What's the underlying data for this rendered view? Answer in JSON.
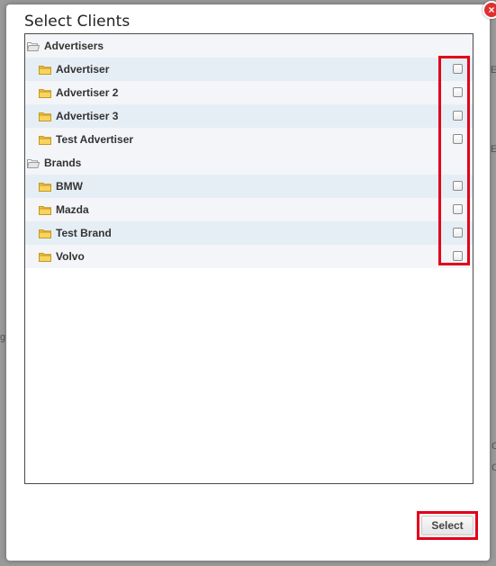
{
  "dialog": {
    "title": "Select Clients",
    "close_symbol": "×"
  },
  "tree": {
    "groups": [
      {
        "label": "Advertisers",
        "icon": "folder-open-icon",
        "items": [
          {
            "label": "Advertiser",
            "icon": "folder-icon",
            "checked": false
          },
          {
            "label": "Advertiser 2",
            "icon": "folder-icon",
            "checked": false
          },
          {
            "label": "Advertiser 3",
            "icon": "folder-icon",
            "checked": false
          },
          {
            "label": "Test Advertiser",
            "icon": "folder-icon",
            "checked": false
          }
        ]
      },
      {
        "label": "Brands",
        "icon": "folder-open-icon",
        "items": [
          {
            "label": "BMW",
            "icon": "folder-icon",
            "checked": false
          },
          {
            "label": "Mazda",
            "icon": "folder-icon",
            "checked": false
          },
          {
            "label": "Test Brand",
            "icon": "folder-icon",
            "checked": false
          },
          {
            "label": "Volvo",
            "icon": "folder-icon",
            "checked": false
          }
        ]
      }
    ]
  },
  "footer": {
    "select_label": "Select"
  },
  "colors": {
    "highlight": "#e2001a",
    "close_button": "#e03030",
    "row_alt": "#e6eef5",
    "row_plain": "#f3f5f8",
    "folder": "#f0c040"
  },
  "background": {
    "fragments": [
      "E",
      "E",
      "g",
      "C",
      "C"
    ]
  }
}
